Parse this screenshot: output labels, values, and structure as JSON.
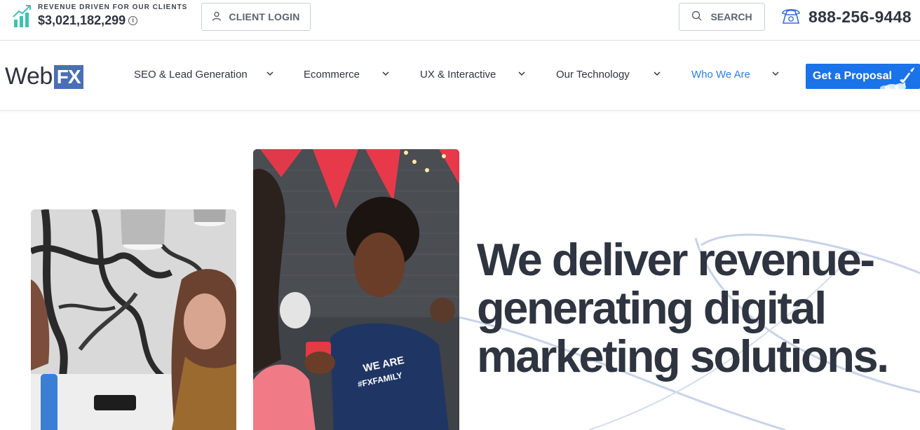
{
  "topbar": {
    "revenue_label": "REVENUE DRIVEN FOR OUR CLIENTS",
    "revenue_value": "$3,021,182,299",
    "revenue_info_icon": "info-icon",
    "client_login_label": "CLIENT LOGIN",
    "client_login_icon": "user-icon",
    "search_label": "SEARCH",
    "search_icon": "search-icon",
    "phone_icon": "telephone-icon",
    "phone_number": "888-256-9448"
  },
  "nav": {
    "logo_web": "Web",
    "logo_fx": "FX",
    "items": [
      {
        "label": "SEO & Lead Generation",
        "active": false
      },
      {
        "label": "Ecommerce",
        "active": false
      },
      {
        "label": "UX & Interactive",
        "active": false
      },
      {
        "label": "Our Technology",
        "active": false
      },
      {
        "label": "Who We Are",
        "active": true
      }
    ],
    "cta_label": "Get a Proposal",
    "cta_icon": "rocket-icon"
  },
  "hero": {
    "headline": "We deliver revenue-generating digital marketing solutions.",
    "headline_lines": [
      "We deliver revenue-",
      "generating digital",
      "marketing solutions."
    ],
    "photo_left": "office-meeting-photo",
    "photo_right": "team-member-photo",
    "shirt_text": "WE ARE #FXFAMILY"
  },
  "colors": {
    "accent": "#1a73e8",
    "active_nav": "#2f7ee0",
    "logo_fx_bg": "#4a6fb5",
    "text": "#2e3440",
    "revenue_icon": "#3ec1b0"
  }
}
